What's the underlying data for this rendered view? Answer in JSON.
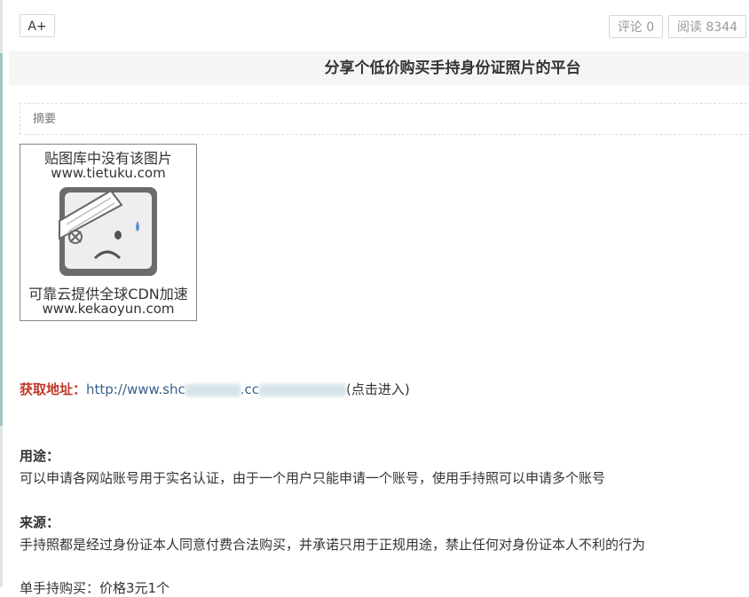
{
  "toolbar": {
    "font_label": "A+",
    "comment_label": "评论 0",
    "read_label": "阅读 8344"
  },
  "article": {
    "title": "分享个低价购买手持身份证照片的平台",
    "summary_label": "摘要",
    "placeholder_image": {
      "line1": "贴图库中没有该图片",
      "line2": "www.tietuku.com",
      "line3": "可靠云提供全球CDN加速",
      "line4": "www.kekaoyun.com",
      "icon": "sad-bandaged-face-icon"
    },
    "address_label": "获取地址：",
    "address_link_part1": "http://www.shc",
    "address_link_part2": ".cc",
    "address_suffix": "(点击进入)",
    "usage_heading": "用途：",
    "usage_text": "可以申请各网站账号用于实名认证，由于一个用户只能申请一个账号，使用手持照可以申请多个账号",
    "source_heading": "来源：",
    "source_text": "手持照都是经过身份证本人同意付费合法购买，并承诺只用于正规用途，禁止任何对身份证本人不利的行为",
    "price_text": "单手持购买：价格3元1个"
  },
  "colors": {
    "accent_red": "#c0392b",
    "link_blue": "#3a5f8a",
    "title_bar_bg": "#f5f5f5"
  }
}
